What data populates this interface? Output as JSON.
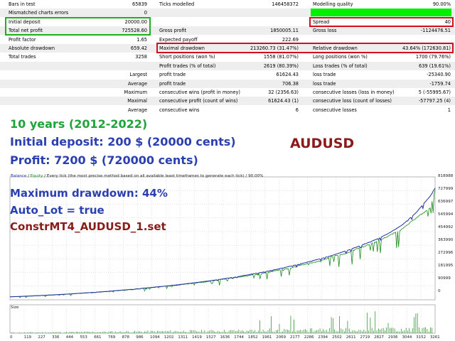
{
  "report": {
    "rows": [
      {
        "l1": "Bars in test",
        "v1": "65839",
        "l2": "Ticks modelled",
        "v2": "146458372",
        "l3": "Modelling quality",
        "v3": "90.00%"
      },
      {
        "l1": "Mismatched charts errors",
        "v1": "0",
        "l2": "",
        "v2": "",
        "l3": "",
        "v3": ""
      },
      {
        "l1": "Initial deposit",
        "v1": "20000.00",
        "l2": "",
        "v2": "",
        "l3": "Spread",
        "v3": "40"
      },
      {
        "l1": "Total net profit",
        "v1": "725528.60",
        "l2": "Gross profit",
        "v2": "1850005.11",
        "l3": "Gross loss",
        "v3": "-1124476.51"
      },
      {
        "l1": "Profit factor",
        "v1": "1.65",
        "l2": "Expected payoff",
        "v2": "222.69",
        "l3": "",
        "v3": ""
      },
      {
        "l1": "Absolute drawdown",
        "v1": "659.42",
        "l2": "Maximal drawdown",
        "v2": "213260.73 (31.47%)",
        "l3": "Relative drawdown",
        "v3": "43.64% (172630.81)"
      },
      {
        "l1": "Total trades",
        "v1": "3258",
        "l2": "Short positions (won %)",
        "v2": "1558 (81.07%)",
        "l3": "Long positions (won %)",
        "v3": "1700 (79.76%)"
      },
      {
        "l1": "",
        "v1": "",
        "l2": "Profit trades (% of total)",
        "v2": "2619 (80.39%)",
        "l3": "Loss trades (% of total)",
        "v3": "639 (19.61%)"
      },
      {
        "l1": "",
        "v1": "Largest",
        "l2": "profit trade",
        "v2": "61624.43",
        "l3": "loss trade",
        "v3": "-25340.90"
      },
      {
        "l1": "",
        "v1": "Average",
        "l2": "profit trade",
        "v2": "706.38",
        "l3": "loss trade",
        "v3": "-1759.74"
      },
      {
        "l1": "",
        "v1": "Maximum",
        "l2": "consecutive wins (profit in money)",
        "v2": "32 (2356.63)",
        "l3": "consecutive losses (loss in money)",
        "v3": "5 (-55995.67)"
      },
      {
        "l1": "",
        "v1": "Maximal",
        "l2": "consecutive profit (count of wins)",
        "v2": "61624.43 (1)",
        "l3": "consecutive loss (count of losses)",
        "v3": "-57797.25 (4)"
      },
      {
        "l1": "",
        "v1": "Average",
        "l2": "consecutive wins",
        "v2": "6",
        "l3": "consecutive losses",
        "v3": "1"
      }
    ],
    "quality_percent": 90
  },
  "overlay": {
    "years": "10 years (2012-2022)",
    "deposit": "Initial deposit:  200 $ (20000 cents)",
    "profit": "Profit:         7200 $ (720000 cents)",
    "symbol": "AUDUSD",
    "drawdown": "Maximum drawdown: 44%",
    "autolot": "Auto_Lot = true",
    "setfile": "ConstrMT4_AUDUSD_1.set"
  },
  "chart": {
    "caption_balance": "Balance",
    "caption_sep": " / ",
    "caption_equity": "Equity",
    "caption_rest": " / Every tick (the most precise method based on all available least timeframes to generate each tick) / 90.00%",
    "size_label": "Size",
    "colors": {
      "balance": "#1f2fa3",
      "equity": "#1a8a1a",
      "volume": "#1a8a1a",
      "grid": "#c8c8c8"
    },
    "yticks": [
      "818988",
      "727999",
      "636997",
      "545994",
      "454992",
      "363990",
      "272996",
      "181995",
      "90999",
      "0"
    ],
    "xticks": [
      "0",
      "119",
      "227",
      "336",
      "444",
      "553",
      "661",
      "769",
      "878",
      "986",
      "1094",
      "1202",
      "1311",
      "1419",
      "1527",
      "1636",
      "1744",
      "1852",
      "1961",
      "2069",
      "2177",
      "2286",
      "2394",
      "2502",
      "2611",
      "2719",
      "2827",
      "2936",
      "3044",
      "3152",
      "3261"
    ]
  },
  "chart_data": {
    "type": "line",
    "x": [
      0,
      119,
      227,
      336,
      444,
      553,
      661,
      769,
      878,
      986,
      1094,
      1202,
      1311,
      1419,
      1527,
      1636,
      1744,
      1852,
      1961,
      2069,
      2177,
      2286,
      2394,
      2502,
      2611,
      2719,
      2827,
      2936,
      3044,
      3152,
      3261,
      3300
    ],
    "series": [
      {
        "name": "Balance",
        "values": [
          20000,
          24000,
          28000,
          33000,
          38000,
          44000,
          50000,
          57000,
          65000,
          73000,
          82000,
          91000,
          101000,
          112000,
          124000,
          137000,
          151000,
          167000,
          184000,
          203000,
          224000,
          246000,
          270000,
          296000,
          327000,
          360000,
          397000,
          441000,
          498000,
          580000,
          690000,
          745000
        ]
      },
      {
        "name": "Equity",
        "values": [
          20000,
          23500,
          27500,
          32500,
          37000,
          43500,
          49500,
          56000,
          64000,
          72000,
          81000,
          90000,
          99500,
          110500,
          120000,
          135000,
          147000,
          160000,
          178000,
          195000,
          212000,
          238000,
          255000,
          288000,
          310000,
          348000,
          380000,
          425000,
          470000,
          545000,
          610000,
          735000
        ]
      }
    ],
    "ylim": [
      0,
      818988
    ],
    "grid": true
  }
}
